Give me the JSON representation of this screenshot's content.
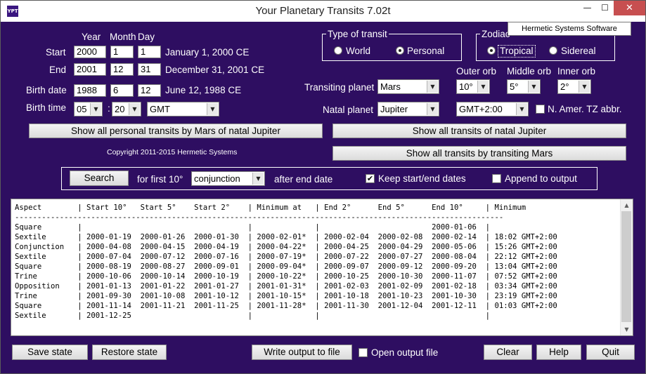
{
  "window": {
    "title": "Your Planetary Transits 7.02t",
    "icon_text": "YPT",
    "controls": {
      "minimize": "—",
      "maximize": "☐",
      "close": "✕"
    }
  },
  "dates": {
    "headers": {
      "year": "Year",
      "month": "Month",
      "day": "Day"
    },
    "start": {
      "label": "Start",
      "year": "2000",
      "month": "1",
      "day": "1",
      "desc": "January 1, 2000 CE"
    },
    "end": {
      "label": "End",
      "year": "2001",
      "month": "12",
      "day": "31",
      "desc": "December 31, 2001 CE"
    },
    "birth_date": {
      "label": "Birth date",
      "year": "1988",
      "month": "6",
      "day": "12",
      "desc": "June 12, 1988 CE"
    },
    "birth_time": {
      "label": "Birth time",
      "hour": "05",
      "sep": ":",
      "minute": "20",
      "tz": "GMT"
    }
  },
  "transit_type": {
    "legend": "Type of transit",
    "options": [
      "World",
      "Personal"
    ],
    "selected": "Personal"
  },
  "zodiac": {
    "legend": "Zodiac",
    "options": [
      "Tropical",
      "Sidereal"
    ],
    "selected": "Tropical",
    "popup_label": "Hermetic Systems Software"
  },
  "planets": {
    "transiting_label": "Transiting planet",
    "transiting_value": "Mars",
    "natal_label": "Natal planet",
    "natal_value": "Jupiter",
    "tz_value": "GMT+2:00",
    "tz_abbr_label": "N. Amer. TZ abbr."
  },
  "orbs": {
    "outer_label": "Outer orb",
    "outer_value": "10°",
    "middle_label": "Middle orb",
    "middle_value": "5°",
    "inner_label": "Inner orb",
    "inner_value": "2°"
  },
  "buttons": {
    "show_personal": "Show all personal transits by Mars of natal Jupiter",
    "show_natal": "Show all transits of natal Jupiter",
    "show_transiting": "Show all transits by transiting Mars",
    "search": "Search",
    "save_state": "Save state",
    "restore_state": "Restore state",
    "write_output": "Write output to file",
    "clear": "Clear",
    "help": "Help",
    "quit": "Quit"
  },
  "copyright": "Copyright 2011-2015 Hermetic Systems",
  "search_bar": {
    "for_first_label": "for first 10°",
    "aspect_value": "conjunction",
    "after_end_label": "after end date",
    "keep_dates_label": "Keep start/end dates",
    "keep_dates_checked": true,
    "append_label": "Append to output",
    "append_checked": false
  },
  "open_output_label": "Open output file",
  "output": {
    "header": "Aspect        | Start 10°   Start 5°    Start 2°    | Minimum at   | End 2°      End 5°      End 10°     | Minimum",
    "divider": "-------------------------------------------------------------------------------------------------------------",
    "rows": [
      "Square        |                                     |              |                         2000-01-06  |",
      "Sextile       | 2000-01-19  2000-01-26  2000-01-30  | 2000-02-01*  | 2000-02-04  2000-02-08  2000-02-14  | 18:02 GMT+2:00",
      "Conjunction   | 2000-04-08  2000-04-15  2000-04-19  | 2000-04-22*  | 2000-04-25  2000-04-29  2000-05-06  | 15:26 GMT+2:00",
      "Sextile       | 2000-07-04  2000-07-12  2000-07-16  | 2000-07-19*  | 2000-07-22  2000-07-27  2000-08-04  | 22:12 GMT+2:00",
      "Square        | 2000-08-19  2000-08-27  2000-09-01  | 2000-09-04*  | 2000-09-07  2000-09-12  2000-09-20  | 13:04 GMT+2:00",
      "Trine         | 2000-10-06  2000-10-14  2000-10-19  | 2000-10-22*  | 2000-10-25  2000-10-30  2000-11-07  | 07:52 GMT+2:00",
      "Opposition    | 2001-01-13  2001-01-22  2001-01-27  | 2001-01-31*  | 2001-02-03  2001-02-09  2001-02-18  | 03:34 GMT+2:00",
      "Trine         | 2001-09-30  2001-10-08  2001-10-12  | 2001-10-15*  | 2001-10-18  2001-10-23  2001-10-30  | 23:19 GMT+2:00",
      "Square        | 2001-11-14  2001-11-21  2001-11-25  | 2001-11-28*  | 2001-11-30  2001-12-04  2001-12-11  | 01:03 GMT+2:00",
      "Sextile       | 2001-12-25                          |              |                                     |"
    ]
  }
}
